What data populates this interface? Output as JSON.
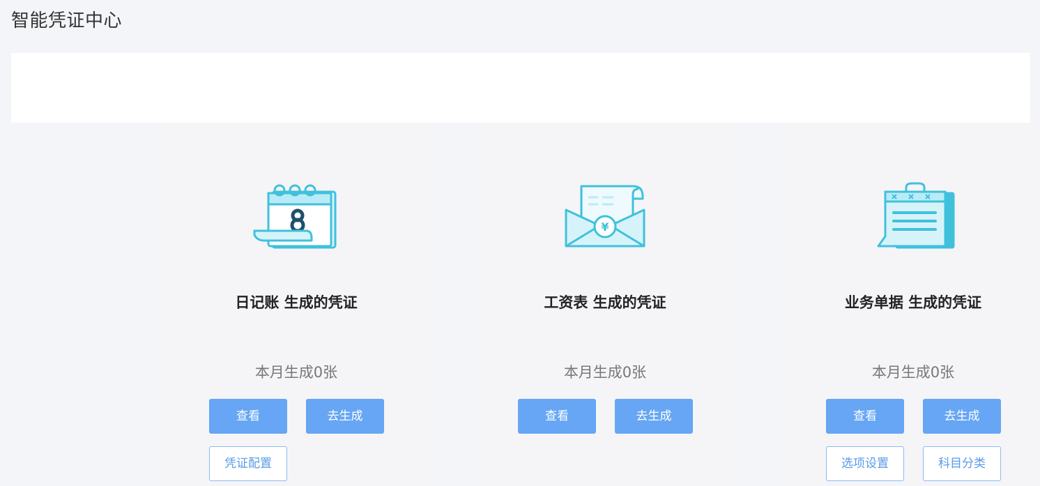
{
  "page": {
    "title": "智能凭证中心"
  },
  "cards": [
    {
      "title": "日记账 生成的凭证",
      "count_text": "本月生成0张",
      "icon": "calendar-icon",
      "buttons": {
        "view": "查看",
        "generate": "去生成",
        "extra1": "凭证配置"
      }
    },
    {
      "title": "工资表 生成的凭证",
      "count_text": "本月生成0张",
      "icon": "salary-envelope-icon",
      "buttons": {
        "view": "查看",
        "generate": "去生成"
      }
    },
    {
      "title": "业务单据 生成的凭证",
      "count_text": "本月生成0张",
      "icon": "business-document-icon",
      "buttons": {
        "view": "查看",
        "generate": "去生成",
        "extra1": "选项设置",
        "extra2": "科目分类"
      }
    }
  ],
  "colors": {
    "primary_button": "#66a6f4",
    "outline_border": "#8cbaf3",
    "icon_stroke": "#3fc1dc",
    "icon_fill": "#d6f3fa",
    "card_bg": "#f5f5f7",
    "page_bg": "#f4f5f9"
  }
}
